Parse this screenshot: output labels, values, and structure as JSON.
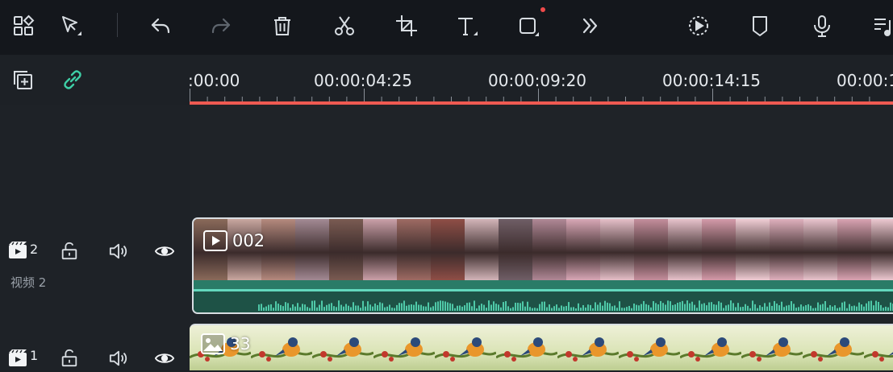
{
  "toolbar": {
    "icons": [
      "layout-icon",
      "select-arrow-icon",
      "undo-icon",
      "redo-icon",
      "delete-icon",
      "cut-icon",
      "crop-icon",
      "text-icon",
      "shape-icon",
      "more-icon",
      "speed-icon",
      "marker-icon",
      "mic-icon",
      "music-list-icon"
    ]
  },
  "timeline": {
    "ruler": [
      "00:00",
      "00:00:04:25",
      "00:00:09:20",
      "00:00:14:15",
      "00:00:1"
    ],
    "ruler_first_prefix": ":"
  },
  "tracks": [
    {
      "number": "2",
      "name": "视频 2",
      "clip_label": "002"
    },
    {
      "number": "1",
      "name": "",
      "clip_label": "33"
    }
  ],
  "colors": {
    "playline": "#ee5a52",
    "accent_link": "#3ecfa6",
    "clip_green": "#2a7b67"
  }
}
